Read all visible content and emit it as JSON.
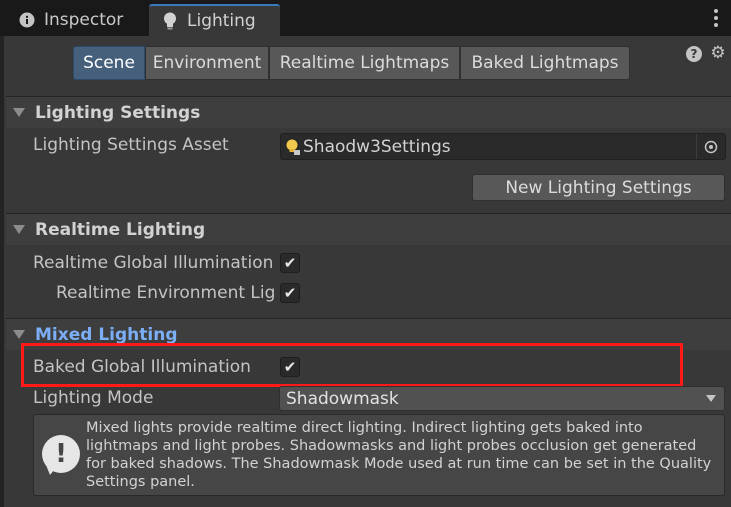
{
  "tabs": [
    {
      "label": "Inspector",
      "icon": "info-icon"
    },
    {
      "label": "Lighting",
      "icon": "lightbulb-icon",
      "active": true
    }
  ],
  "top_buttons": [
    "Scene",
    "Environment",
    "Realtime Lightmaps",
    "Baked Lightmaps"
  ],
  "active_top_button": "Scene",
  "sections": {
    "lighting_settings": {
      "title": "Lighting Settings",
      "asset_label": "Lighting Settings Asset",
      "asset_value": "Shaodw3Settings",
      "new_button": "New Lighting Settings"
    },
    "realtime": {
      "title": "Realtime Lighting",
      "rows": [
        {
          "label": "Realtime Global Illumination",
          "checked": true
        },
        {
          "label": "Realtime Environment Lighting",
          "checked": true
        }
      ]
    },
    "mixed": {
      "title": "Mixed Lighting",
      "baked_gi_label": "Baked Global Illumination",
      "baked_gi_checked": true,
      "mode_label": "Lighting Mode",
      "mode_value": "Shadowmask",
      "help_text": "Mixed lights provide realtime direct lighting. Indirect lighting gets baked into lightmaps and light probes. Shadowmasks and light probes occlusion get generated for baked shadows. The Shadowmask Mode used at run time can be set in the Quality Settings panel."
    }
  },
  "colors": {
    "background": "#383838",
    "tab_bar": "#191919",
    "active_segment": "#46607c",
    "mixed_title": "#7baef4",
    "highlight": "#ff1a1a"
  },
  "check_glyph": "✔"
}
